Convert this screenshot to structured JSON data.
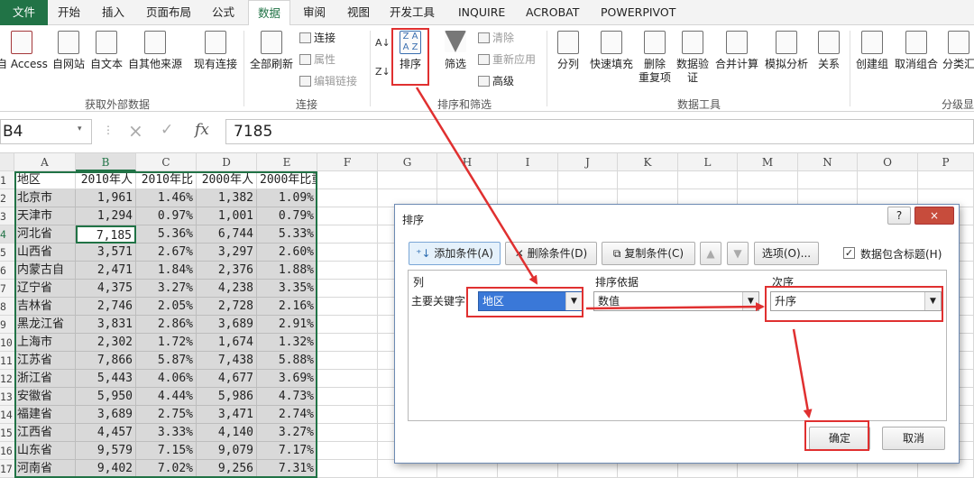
{
  "tabs": [
    "文件",
    "开始",
    "插入",
    "页面布局",
    "公式",
    "数据",
    "审阅",
    "视图",
    "开发工具",
    "INQUIRE",
    "ACROBAT",
    "POWERPIVOT"
  ],
  "ribbon": {
    "ext_data": [
      "自 Access",
      "自网站",
      "自文本",
      "自其他来源",
      "现有连接"
    ],
    "refresh": "全部刷新",
    "conn_items": [
      "连接",
      "属性",
      "编辑链接"
    ],
    "sort_label": "排序",
    "filter_label": "筛选",
    "filter_items": [
      "清除",
      "重新应用",
      "高级"
    ],
    "tools": [
      "分列",
      "快速填充",
      "删除",
      "数据验",
      "合并计算",
      "模拟分析",
      "关系"
    ],
    "tools_line2": [
      "重复项",
      "证"
    ],
    "outline": [
      "创建组",
      "取消组合",
      "分类汇"
    ],
    "groups": [
      "获取外部数据",
      "连接",
      "排序和筛选",
      "数据工具",
      "分级显"
    ]
  },
  "formula_bar": {
    "name_box": "B4",
    "formula": "7185"
  },
  "columns": [
    "A",
    "B",
    "C",
    "D",
    "E",
    "F",
    "G",
    "H",
    "I",
    "J",
    "K",
    "L",
    "M",
    "N",
    "O",
    "P"
  ],
  "rows": [
    [
      "地区",
      "2010年人",
      "2010年比",
      "2000年人",
      "2000年比重"
    ],
    [
      "北京市",
      "1,961",
      "1.46%",
      "1,382",
      "1.09%"
    ],
    [
      "天津市",
      "1,294",
      "0.97%",
      "1,001",
      "0.79%"
    ],
    [
      "河北省",
      "7,185",
      "5.36%",
      "6,744",
      "5.33%"
    ],
    [
      "山西省",
      "3,571",
      "2.67%",
      "3,297",
      "2.60%"
    ],
    [
      "内蒙古自",
      "2,471",
      "1.84%",
      "2,376",
      "1.88%"
    ],
    [
      "辽宁省",
      "4,375",
      "3.27%",
      "4,238",
      "3.35%"
    ],
    [
      "吉林省",
      "2,746",
      "2.05%",
      "2,728",
      "2.16%"
    ],
    [
      "黑龙江省",
      "3,831",
      "2.86%",
      "3,689",
      "2.91%"
    ],
    [
      "上海市",
      "2,302",
      "1.72%",
      "1,674",
      "1.32%"
    ],
    [
      "江苏省",
      "7,866",
      "5.87%",
      "7,438",
      "5.88%"
    ],
    [
      "浙江省",
      "5,443",
      "4.06%",
      "4,677",
      "3.69%"
    ],
    [
      "安徽省",
      "5,950",
      "4.44%",
      "5,986",
      "4.73%"
    ],
    [
      "福建省",
      "3,689",
      "2.75%",
      "3,471",
      "2.74%"
    ],
    [
      "江西省",
      "4,457",
      "3.33%",
      "4,140",
      "3.27%"
    ],
    [
      "山东省",
      "9,579",
      "7.15%",
      "9,079",
      "7.17%"
    ],
    [
      "河南省",
      "9,402",
      "7.02%",
      "9,256",
      "7.31%"
    ]
  ],
  "row_numbers": [
    "1",
    "2",
    "3",
    "4",
    "5",
    "6",
    "7",
    "8",
    "9",
    "10",
    "11",
    "12",
    "13",
    "14",
    "15",
    "16",
    "17"
  ],
  "dialog": {
    "title": "排序",
    "add_condition": "添加条件(A)",
    "delete_condition": "删除条件(D)",
    "copy_condition": "复制条件(C)",
    "options": "选项(O)...",
    "has_header": "数据包含标题(H)",
    "col_header": "列",
    "basis_header": "排序依据",
    "order_header": "次序",
    "primary_key": "主要关键字",
    "key_value": "地区",
    "basis_value": "数值",
    "order_value": "升序",
    "ok": "确定",
    "cancel": "取消",
    "help": "?",
    "close": "×"
  },
  "colors": {
    "excel_green": "#217346",
    "highlight_red": "#e03030"
  }
}
